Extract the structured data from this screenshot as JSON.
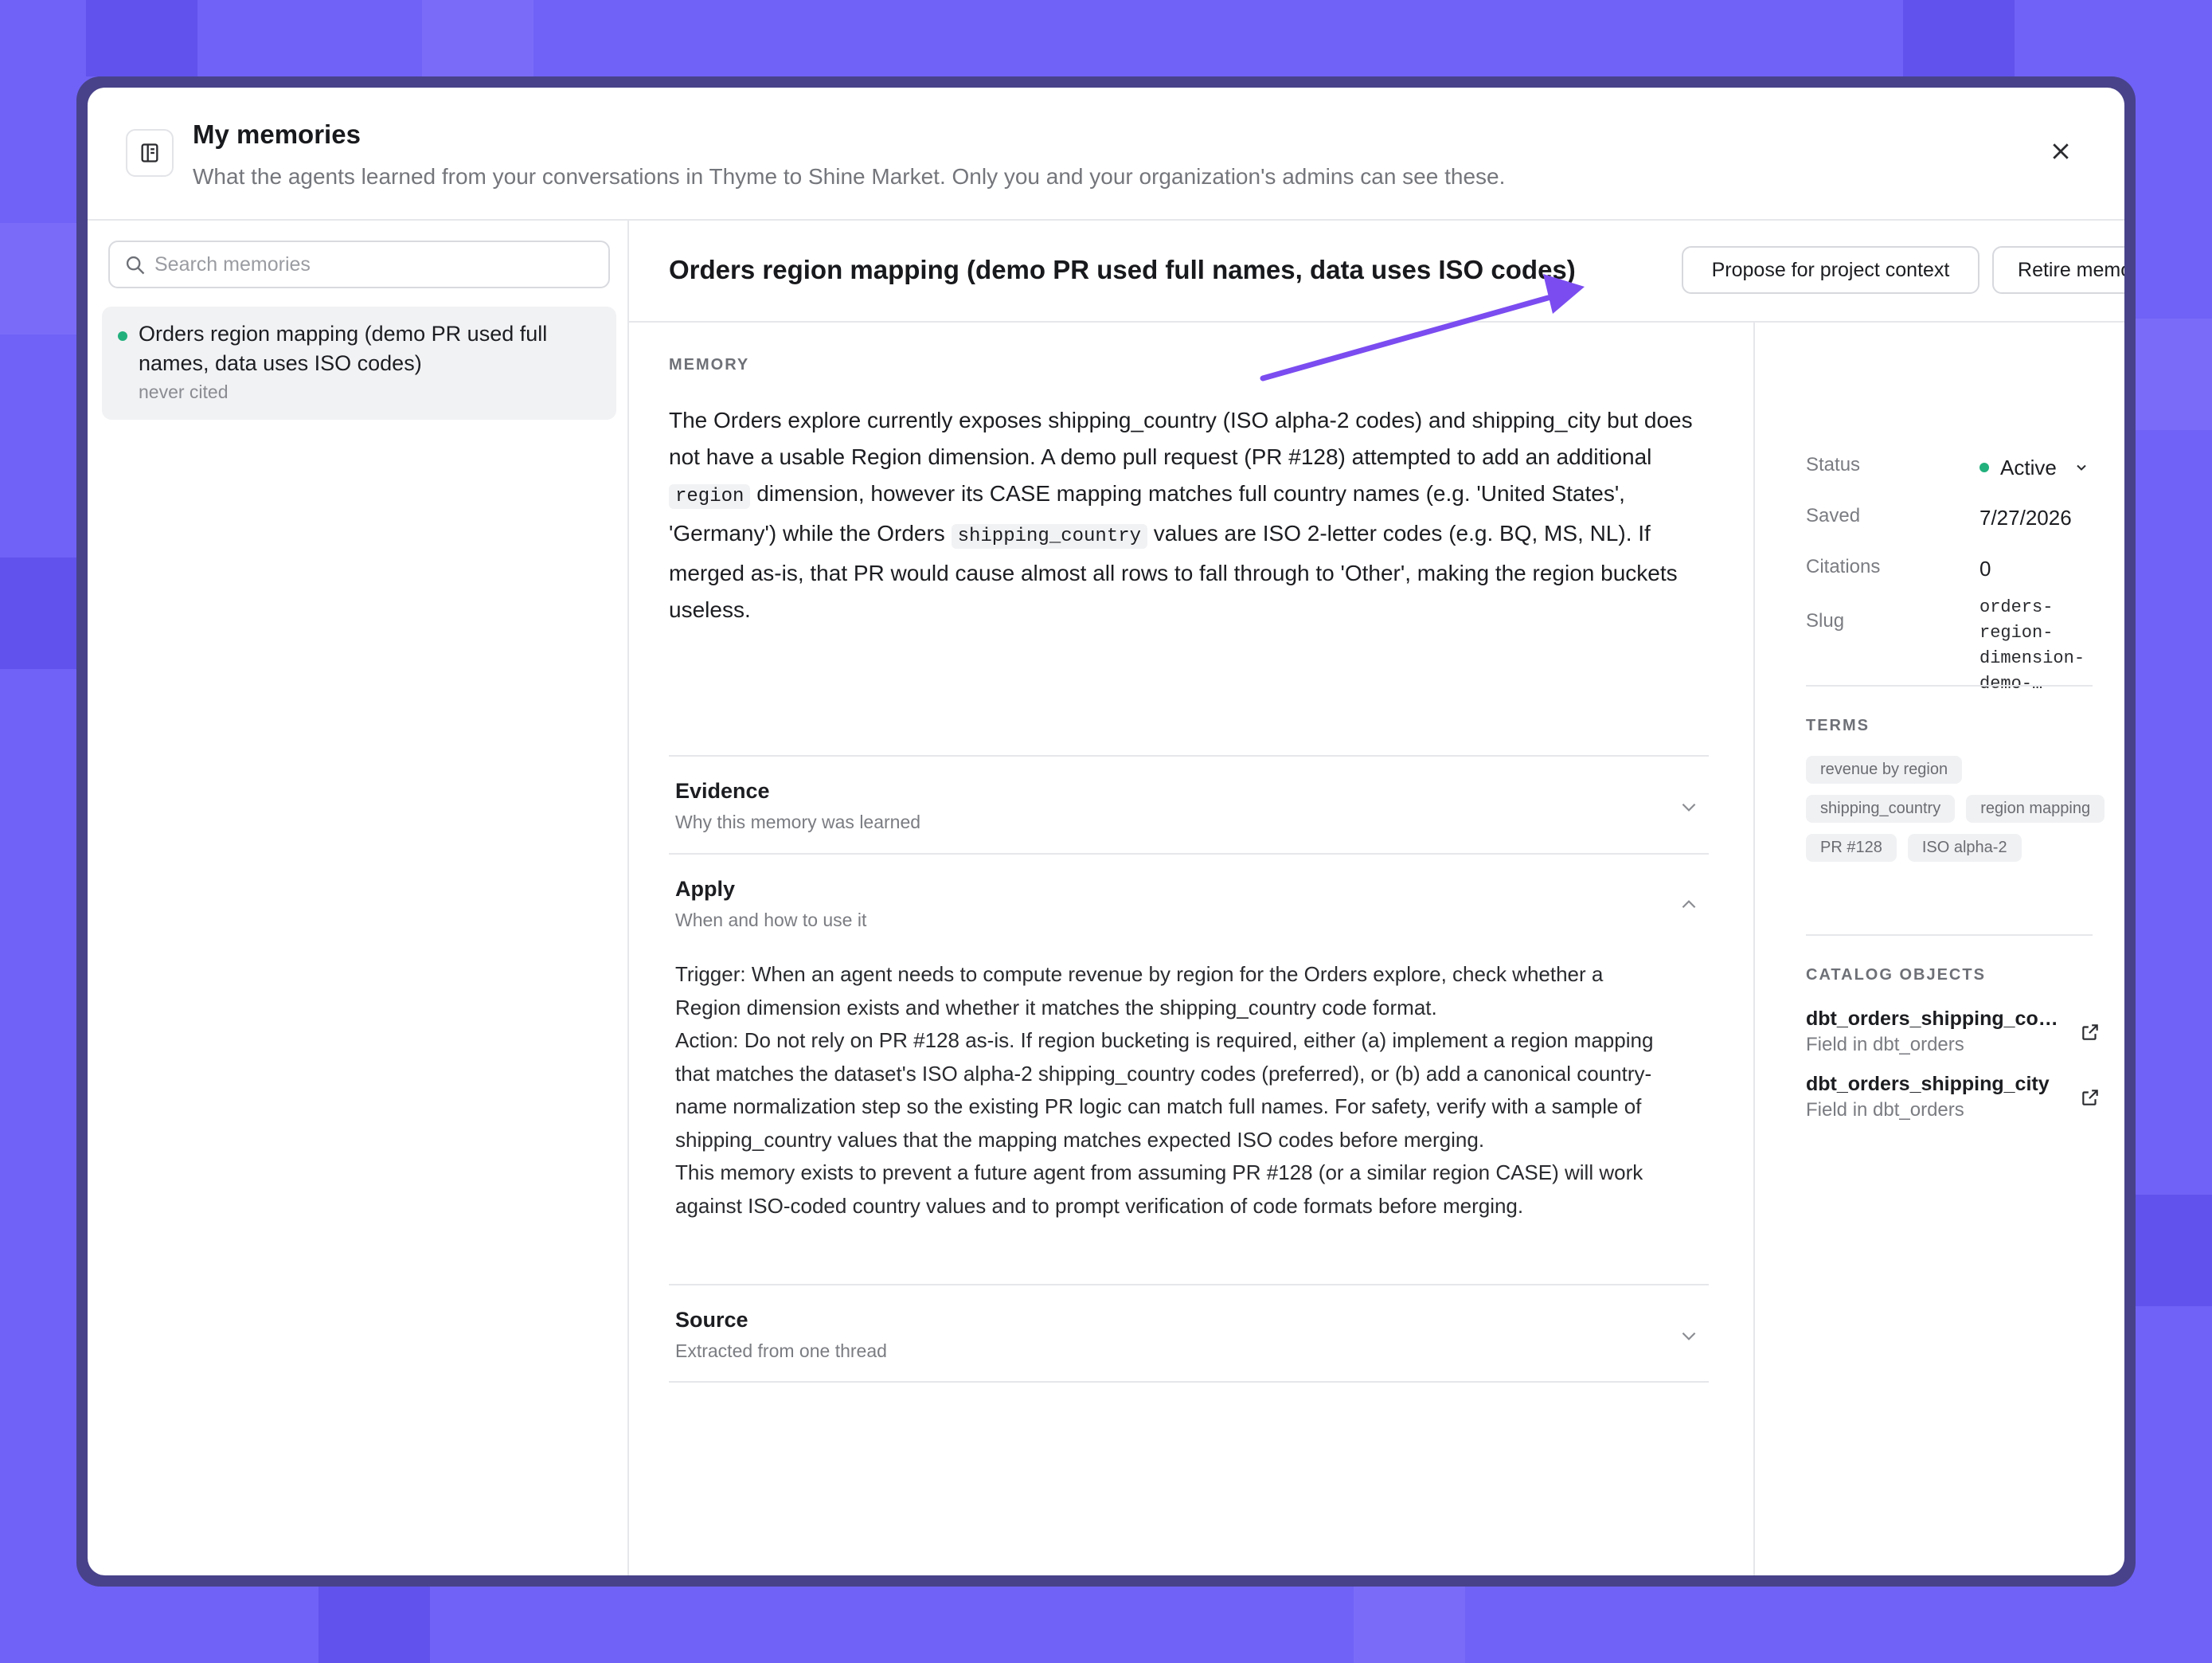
{
  "header": {
    "title": "My memories",
    "subtitle": "What the agents learned from your conversations in Thyme to Shine Market. Only you and your organization's admins can see these.",
    "book_icon": "book-icon",
    "close_icon": "close-icon"
  },
  "sidebar": {
    "search_placeholder": "Search memories",
    "items": [
      {
        "title": "Orders region mapping (demo PR used full names, data uses ISO codes)",
        "meta": "never cited",
        "status_color": "#22b07d"
      }
    ]
  },
  "main": {
    "title": "Orders region mapping (demo PR used full names, data uses ISO codes)",
    "propose_label": "Propose for project context",
    "retire_label": "Retire memory",
    "section_label": "MEMORY",
    "body": {
      "p1": "The Orders explore currently exposes shipping_country (ISO alpha-2 codes) and shipping_city but does not have a usable Region dimension. A demo pull request (PR #128) attempted to add an additional ",
      "code1": "region",
      "p2": " dimension, however its CASE mapping matches full country names (e.g. 'United States', 'Germany') while the Orders ",
      "code2": "shipping_country",
      "p3": " values are ISO 2-letter codes (e.g. BQ, MS, NL). If merged as-is, that PR would cause almost all rows to fall through to 'Other', making the region buckets useless."
    },
    "accordions": [
      {
        "title": "Evidence",
        "subtitle": "Why this memory was learned",
        "expanded": false
      },
      {
        "title": "Apply",
        "subtitle": "When and how to use it",
        "expanded": true,
        "lines": [
          "Trigger: When an agent needs to compute revenue by region for the Orders explore, check whether a Region dimension exists and whether it matches the shipping_country code format.",
          "Action: Do not rely on PR #128 as-is. If region bucketing is required, either (a) implement a region mapping that matches the dataset's ISO alpha-2 shipping_country codes (preferred), or (b) add a canonical country-name normalization step so the existing PR logic can match full names. For safety, verify with a sample of shipping_country values that the mapping matches expected ISO codes before merging.",
          "This memory exists to prevent a future agent from assuming PR #128 (or a similar region CASE) will work against ISO-coded country values and to prompt verification of code formats before merging."
        ]
      },
      {
        "title": "Source",
        "subtitle": "Extracted from one thread",
        "expanded": false
      }
    ]
  },
  "panel": {
    "status_label": "Status",
    "status_value": "Active",
    "saved_label": "Saved",
    "saved_value": "7/27/2026",
    "citations_label": "Citations",
    "citations_value": "0",
    "slug_label": "Slug",
    "slug_line1": "orders-region-",
    "slug_line2": "dimension-demo-…",
    "terms_label": "TERMS",
    "terms": [
      "revenue by region",
      "shipping_country",
      "region mapping",
      "PR #128",
      "ISO alpha-2"
    ],
    "catalog_label": "CATALOG OBJECTS",
    "catalog": [
      {
        "name": "dbt_orders_shipping_country",
        "sub": "Field in dbt_orders"
      },
      {
        "name": "dbt_orders_shipping_city",
        "sub": "Field in dbt_orders"
      }
    ]
  },
  "colors": {
    "accent_arrow": "#7b4cf0",
    "active": "#22b07d",
    "background": "#7062f6"
  }
}
